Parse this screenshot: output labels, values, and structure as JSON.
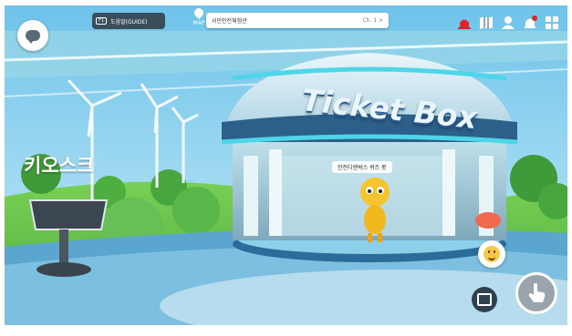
{
  "hud": {
    "guide_key": "F1",
    "guide_label": "도움말(GUIDE)",
    "map_label": "MAP",
    "location": "서민안전체험관",
    "channel": "Ch. 1 >",
    "icons": [
      "alarm-icon",
      "map-icon",
      "profile-icon",
      "notification-bell-icon",
      "menu-grid-icon"
    ]
  },
  "scene": {
    "sign": "Ticket Box",
    "kiosk_label": "키오스크",
    "npc_label": "안전디엔박스 퀴즈 봇"
  },
  "colors": {
    "hud_dark": "#3a4d5a",
    "alert_red": "#d9272e",
    "sky": "#8fd0ef",
    "grass": "#6ccb4a"
  }
}
